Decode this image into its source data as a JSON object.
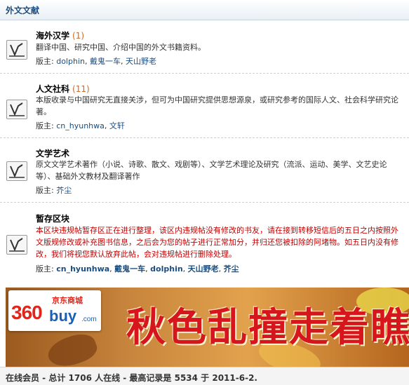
{
  "section_title": "外文文献",
  "forums": [
    {
      "title": "海外汉学",
      "count": "(1)",
      "description": "翻译中国、研究中国、介绍中国的外文书籍资料。",
      "mods_label": "版主:",
      "moderators": [
        "dolphin",
        "戴鬼一车",
        "天山野老"
      ]
    },
    {
      "title": "人文社科",
      "count": "(11)",
      "description": "本版收录与中国研究无直接关涉，但可为中国研究提供思想源泉，或研究参考的国际人文、社会科学研究论著。",
      "mods_label": "版主:",
      "moderators": [
        "cn_hyunhwa",
        "文轩"
      ]
    },
    {
      "title": "文学艺术",
      "count": "",
      "description": "原文文学艺术著作（小说、诗歌、散文、戏剧等）、文学艺术理论及研究（流派、运动、美学、文艺史论等）、基础外文教材及翻译著作",
      "mods_label": "版主:",
      "moderators": [
        "芥尘"
      ]
    },
    {
      "title": "暂存区块",
      "count": "",
      "description": "本区块违规帖暂存区正在进行整理，该区内违规帖没有修改的书友，请在接到转移短信后的五日之内按照外文版规修改或补充图书信息，之后会为您的帖子进行正常加分，并归还您被扣除的阿堵物。如五日内没有修改，我们将视您默认放弃此帖，会对违规帖进行删除处理。",
      "mods_label": "版主:",
      "moderators": [
        "cn_hyunhwa",
        "戴鬼一车",
        "dolphin",
        "天山野老",
        "芥尘"
      ]
    }
  ],
  "banner": {
    "brand_cn": "京东商城",
    "brand_num": "360",
    "brand_word": "buy",
    "brand_domain": ".com",
    "slogan": "秋色乱撞走着瞧"
  },
  "footer": {
    "text": "在线会员 - 总计 1706 人在线 - 最高记录是 5534 于 2011-6-2."
  },
  "colors": {
    "link": "#1a4d80",
    "count": "#d2691e",
    "warning": "#c00000",
    "header_text": "#1a4d80"
  }
}
